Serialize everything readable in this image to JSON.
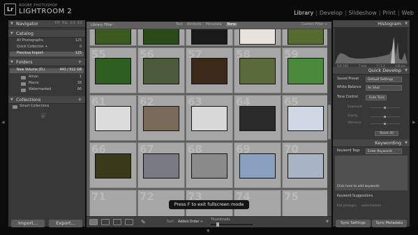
{
  "app": {
    "logo": "Lr",
    "brand_small": "ADOBE PHOTOSHOP",
    "brand": "LIGHTROOM 2"
  },
  "modules": [
    "Library",
    "Develop",
    "Slideshow",
    "Print",
    "Web"
  ],
  "left_panel": {
    "navigator": {
      "title": "Navigator",
      "options": [
        "FIT",
        "FILL",
        "1:1",
        "3:1"
      ]
    },
    "catalog": {
      "title": "Catalog",
      "items": [
        {
          "label": "All Photographs",
          "count": "125"
        },
        {
          "label": "Quick Collection +",
          "count": "0"
        },
        {
          "label": "Previous Import",
          "count": "125"
        }
      ]
    },
    "folders": {
      "title": "Folders",
      "volume": {
        "label": "New Volume (D:)",
        "info": "443 / 912 GB"
      },
      "items": [
        {
          "label": "Aman",
          "count": "1"
        },
        {
          "label": "Macro",
          "count": "38"
        },
        {
          "label": "Watermarked",
          "count": "86"
        }
      ]
    },
    "collections": {
      "title": "Collections",
      "items": [
        {
          "label": "Smart Collections"
        }
      ]
    },
    "import_label": "Import...",
    "export_label": "Export..."
  },
  "filter_bar": {
    "title": "Library Filter :",
    "options": [
      "Text",
      "Attribute",
      "Metadata",
      "None"
    ],
    "active": "None",
    "custom": "Custom Filter ÷"
  },
  "grid": {
    "rows": [
      {
        "numbers": [
          "",
          "",
          "",
          "",
          ""
        ]
      },
      {
        "numbers": [
          "55",
          "56",
          "57",
          "58",
          "59"
        ]
      },
      {
        "numbers": [
          "61",
          "62",
          "63",
          "64",
          "65"
        ]
      },
      {
        "numbers": [
          "66",
          "67",
          "68",
          "69",
          "70"
        ]
      },
      {
        "numbers": [
          "71",
          "72",
          "73",
          "74",
          "75"
        ]
      }
    ]
  },
  "toolbar": {
    "sort_label": "Sort:",
    "sort_value": "Added Order ÷",
    "thumbnails_label": "Thumbnails"
  },
  "toast": "Press F to exit fullscreen mode",
  "right_panel": {
    "histogram": {
      "title": "Histogram",
      "info": [
        "ISO 100",
        "7 mm",
        "f / 1.2",
        "1/8 sec"
      ]
    },
    "quick_develop": {
      "title": "Quick Develop",
      "saved_preset_label": "Saved Preset",
      "saved_preset_value": "Default Settings",
      "white_balance_label": "White Balance",
      "white_balance_value": "As Shot",
      "tone_control_label": "Tone Control",
      "auto_tone": "Auto Tone",
      "sliders": [
        "Exposure",
        "Clarity",
        "Vibrance"
      ],
      "reset_label": "Reset All"
    },
    "keywording": {
      "title": "Keywording",
      "tags_label": "Keyword Tags",
      "tags_value": "Enter Keywords",
      "click_here": "Click here to add keywords",
      "suggestions_label": "Keyword Suggestions",
      "suggestions": [
        "fish photogra",
        "watermarked"
      ]
    },
    "sync_settings_label": "Sync Settings",
    "sync_metadata_label": "Sync Metadata"
  }
}
